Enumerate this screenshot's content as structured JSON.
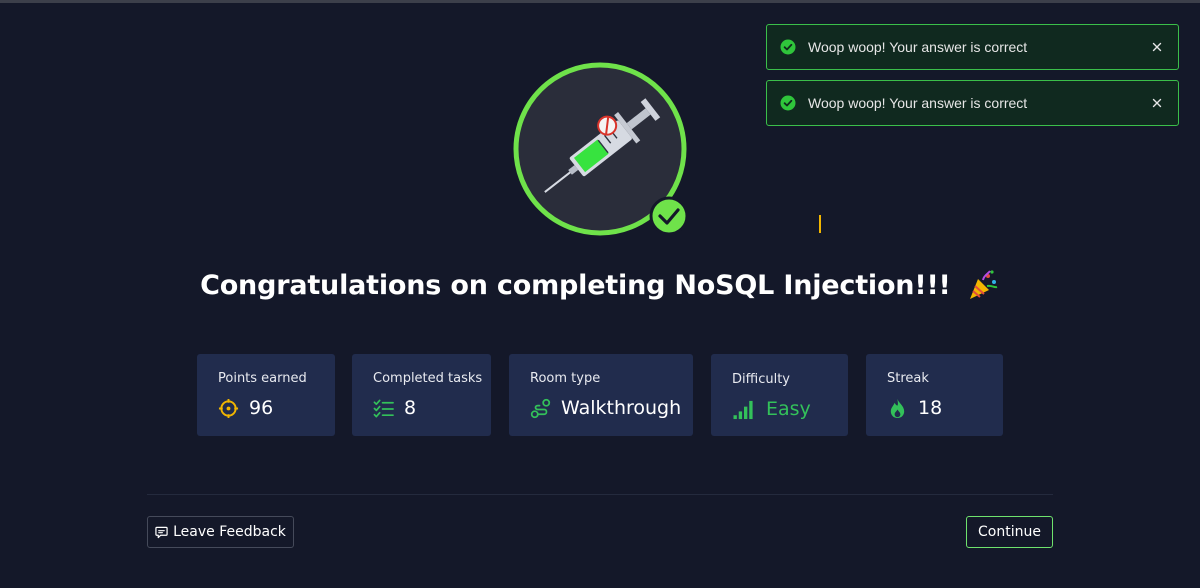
{
  "toasts": [
    {
      "message": "Woop woop! Your answer is correct",
      "icon": "check-circle-icon",
      "close_icon": "close-icon"
    },
    {
      "message": "Woop woop! Your answer is correct",
      "icon": "check-circle-icon",
      "close_icon": "close-icon"
    }
  ],
  "badge": {
    "image": "syringe-badge",
    "completed_icon": "checkmark-icon",
    "accent": "#6fe24a"
  },
  "heading": {
    "text": "Congratulations on completing NoSQL Injection!!!",
    "emoji": "party-popper-icon"
  },
  "stats": [
    {
      "label": "Points earned",
      "value": "96",
      "icon": "target-icon"
    },
    {
      "label": "Completed tasks",
      "value": "8",
      "icon": "checklist-icon"
    },
    {
      "label": "Room type",
      "value": "Walkthrough",
      "icon": "route-icon"
    },
    {
      "label": "Difficulty",
      "value": "Easy",
      "icon": "signal-bars-icon",
      "color": "#33c15a"
    },
    {
      "label": "Streak",
      "value": "18",
      "icon": "flame-icon"
    }
  ],
  "footer": {
    "feedback_label": "Leave Feedback",
    "feedback_icon": "comment-icon",
    "continue_label": "Continue"
  },
  "colors": {
    "background": "#141829",
    "card": "#212c4d",
    "accent_green": "#6fe26d",
    "toast_bg": "#10291f"
  }
}
